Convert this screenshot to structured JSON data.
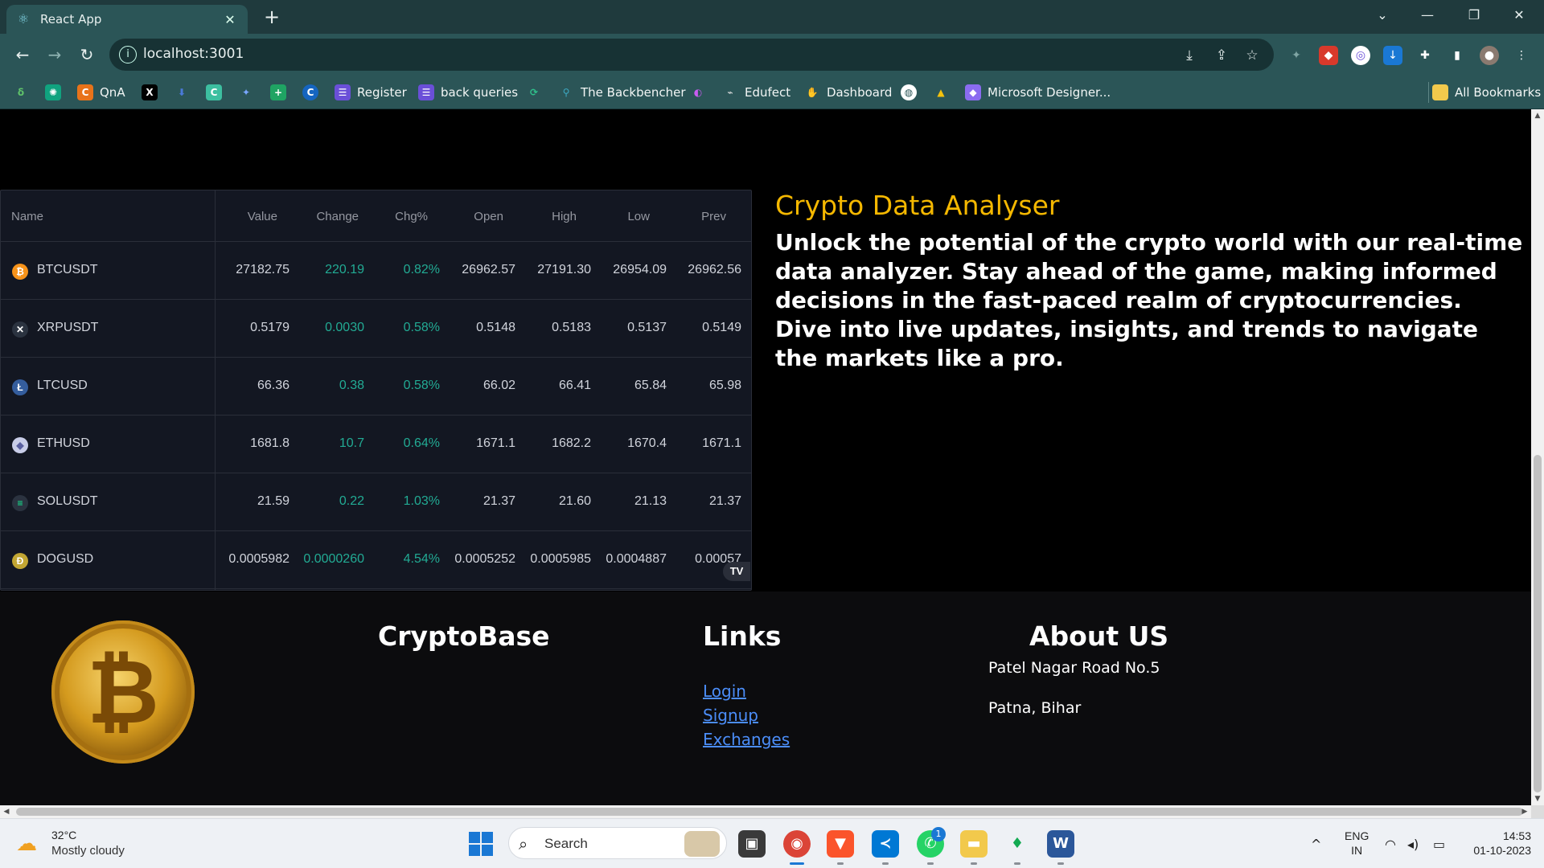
{
  "browser": {
    "tab_title": "React App",
    "tab_close": "✕",
    "new_tab": "+",
    "url": "localhost:3001",
    "bookmarks": [
      {
        "label": "QnA",
        "icon": "c-orange-icon",
        "color": "#e8731a"
      },
      {
        "label": "Register",
        "icon": "form-icon",
        "color": "#6a4fd8"
      },
      {
        "label": "back queries",
        "icon": "form-icon",
        "color": "#6a4fd8"
      },
      {
        "label": "The Backbencher",
        "icon": "backbencher-icon",
        "color": "#3da8c2"
      },
      {
        "label": "Edufect",
        "icon": "edufect-icon",
        "color": "#e0e0e0"
      },
      {
        "label": "Dashboard",
        "icon": "hand-icon",
        "color": "#f2b600"
      },
      {
        "label": "Microsoft Designer...",
        "icon": "designer-icon",
        "color": "#8a6cf0"
      }
    ],
    "all_bookmarks": "All Bookmarks"
  },
  "ticker": {
    "headers": [
      "Name",
      "Value",
      "Change",
      "Chg%",
      "Open",
      "High",
      "Low",
      "Prev"
    ],
    "rows": [
      {
        "symbol": "BTCUSDT",
        "icon": "bitcoin-icon",
        "icon_color": "#f7931a",
        "value": "27182.75",
        "change": "220.19",
        "chg_pct": "0.82%",
        "open": "26962.57",
        "high": "27191.30",
        "low": "26954.09",
        "prev": "26962.56"
      },
      {
        "symbol": "XRPUSDT",
        "icon": "xrp-icon",
        "icon_color": "#2b3340",
        "value": "0.5179",
        "change": "0.0030",
        "chg_pct": "0.58%",
        "open": "0.5148",
        "high": "0.5183",
        "low": "0.5137",
        "prev": "0.5149"
      },
      {
        "symbol": "LTCUSD",
        "icon": "litecoin-icon",
        "icon_color": "#345d9d",
        "value": "66.36",
        "change": "0.38",
        "chg_pct": "0.58%",
        "open": "66.02",
        "high": "66.41",
        "low": "65.84",
        "prev": "65.98"
      },
      {
        "symbol": "ETHUSD",
        "icon": "ethereum-icon",
        "icon_color": "#c8cde8",
        "value": "1681.8",
        "change": "10.7",
        "chg_pct": "0.64%",
        "open": "1671.1",
        "high": "1682.2",
        "low": "1670.4",
        "prev": "1671.1"
      },
      {
        "symbol": "SOLUSDT",
        "icon": "solana-icon",
        "icon_color": "#2b3340",
        "value": "21.59",
        "change": "0.22",
        "chg_pct": "1.03%",
        "open": "21.37",
        "high": "21.60",
        "low": "21.13",
        "prev": "21.37"
      },
      {
        "symbol": "DOGUSD",
        "icon": "dogecoin-icon",
        "icon_color": "#c2a633",
        "value": "0.0005982",
        "change": "0.0000260",
        "chg_pct": "4.54%",
        "open": "0.0005252",
        "high": "0.0005985",
        "low": "0.0004887",
        "prev": "0.00057"
      }
    ],
    "colors": {
      "positive": "#22ab94",
      "background": "#131722"
    }
  },
  "hero": {
    "title": "Crypto Data Analyser",
    "text": "Unlock the potential of the crypto world with our real-time data analyzer. Stay ahead of the game, making informed decisions in the fast-paced realm of cryptocurrencies. Dive into live updates, insights, and trends to navigate the markets like a pro.",
    "title_color": "#f5b800"
  },
  "footer": {
    "brand": "CryptoBase",
    "links_heading": "Links",
    "links": [
      "Login",
      "Signup",
      "Exchanges"
    ],
    "about_heading": "About US",
    "address_line1": "Patel Nagar Road No.5",
    "address_line2": "Patna, Bihar"
  },
  "taskbar": {
    "temperature": "32°C",
    "weather": "Mostly cloudy",
    "search_label": "Search",
    "whatsapp_badge": "1",
    "lang_line1": "ENG",
    "lang_line2": "IN",
    "time": "14:53",
    "date": "01-10-2023"
  }
}
